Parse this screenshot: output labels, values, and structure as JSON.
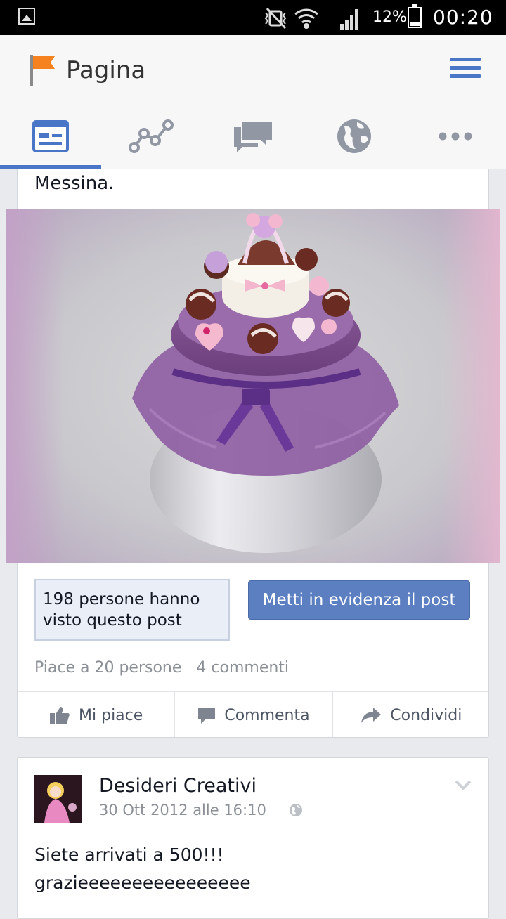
{
  "status_bar": {
    "battery_percent": "12%",
    "time": "00:20",
    "icons": [
      "gallery-icon",
      "mute-vibrate-icon",
      "wifi-icon",
      "signal-icon",
      "battery-icon"
    ]
  },
  "header": {
    "title": "Pagina",
    "icon": "flag-icon",
    "menu_icon": "menu-icon",
    "accent_color": "#4a76c8",
    "flag_color": "#f5821f"
  },
  "tabs": [
    {
      "name": "feed",
      "icon": "news-feed-icon",
      "active": true
    },
    {
      "name": "insights",
      "icon": "line-chart-icon",
      "active": false
    },
    {
      "name": "messages",
      "icon": "chat-bubbles-icon",
      "active": false
    },
    {
      "name": "globe",
      "icon": "globe-icon",
      "active": false
    },
    {
      "name": "more",
      "icon": "more-dots-icon",
      "active": false
    }
  ],
  "post1": {
    "text_tail": "Messina.",
    "reach_text": "198 persone hanno visto questo post",
    "boost_label": "Metti in evidenza il post",
    "likes_text": "Piace a 20 persone",
    "comments_text": "4 commenti",
    "actions": {
      "like": "Mi piace",
      "comment": "Commenta",
      "share": "Condividi"
    }
  },
  "post2": {
    "author": "Desideri Creativi",
    "date": "30 Ott 2012 alle 16:10",
    "body_line1": "Siete arrivati a 500!!!",
    "body_line2": "grazieeeeeeeeeeeeeeee"
  }
}
